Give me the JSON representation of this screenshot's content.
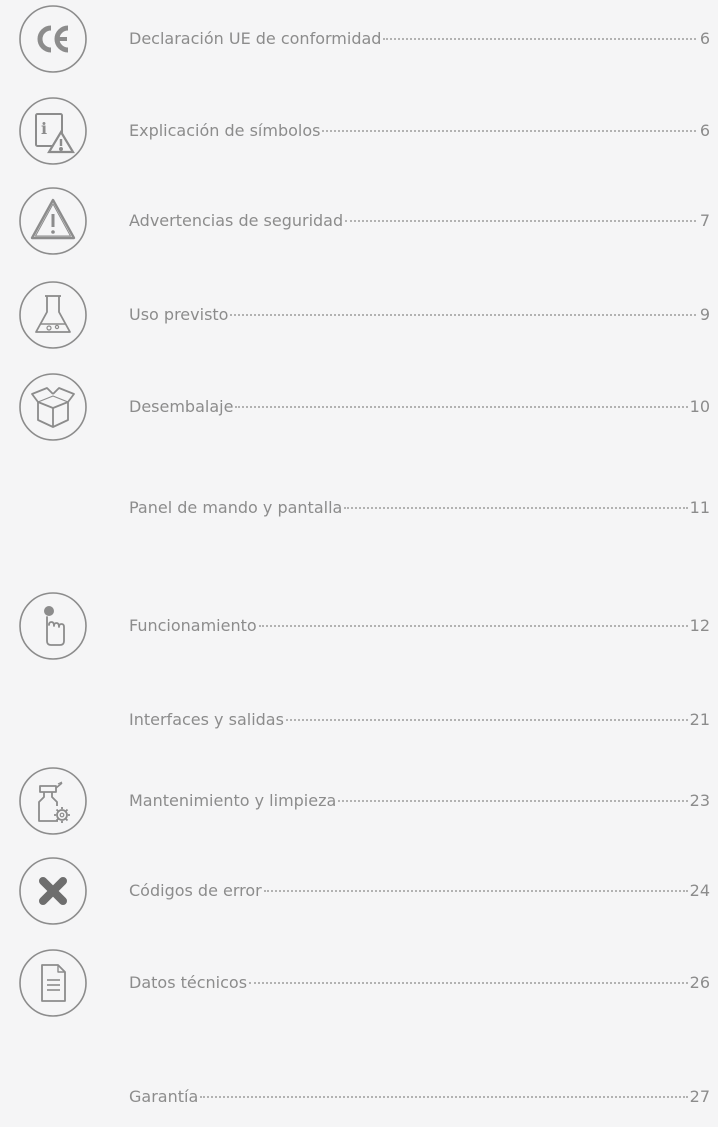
{
  "toc": {
    "entries": [
      {
        "title": "Declaración UE de conformidad",
        "page": "6",
        "icon": "ce-mark-icon"
      },
      {
        "title": "Explicación de símbolos",
        "page": "6",
        "icon": "info-warning-icon"
      },
      {
        "title": "Advertencias de seguridad",
        "page": "7",
        "icon": "warning-triangle-icon"
      },
      {
        "title": "Uso previsto",
        "page": "9",
        "icon": "flask-icon"
      },
      {
        "title": "Desembalaje",
        "page": "10",
        "icon": "open-box-icon"
      },
      {
        "title": "Panel de mando y pantalla",
        "page": "11",
        "icon": ""
      },
      {
        "title": "Funcionamiento",
        "page": "12",
        "icon": "finger-press-icon"
      },
      {
        "title": "Interfaces y salidas",
        "page": "21",
        "icon": ""
      },
      {
        "title": "Mantenimiento y limpieza",
        "page": "23",
        "icon": "spray-gear-icon"
      },
      {
        "title": "Códigos de error",
        "page": "24",
        "icon": "cross-icon"
      },
      {
        "title": "Datos técnicos",
        "page": "26",
        "icon": "document-icon"
      },
      {
        "title": "Garantía",
        "page": "27",
        "icon": ""
      }
    ]
  },
  "colors": {
    "background": "#f5f5f6",
    "text": "#8c8c8c",
    "icon_stroke": "#8c8c8c",
    "leader": "#b2b2b2"
  }
}
